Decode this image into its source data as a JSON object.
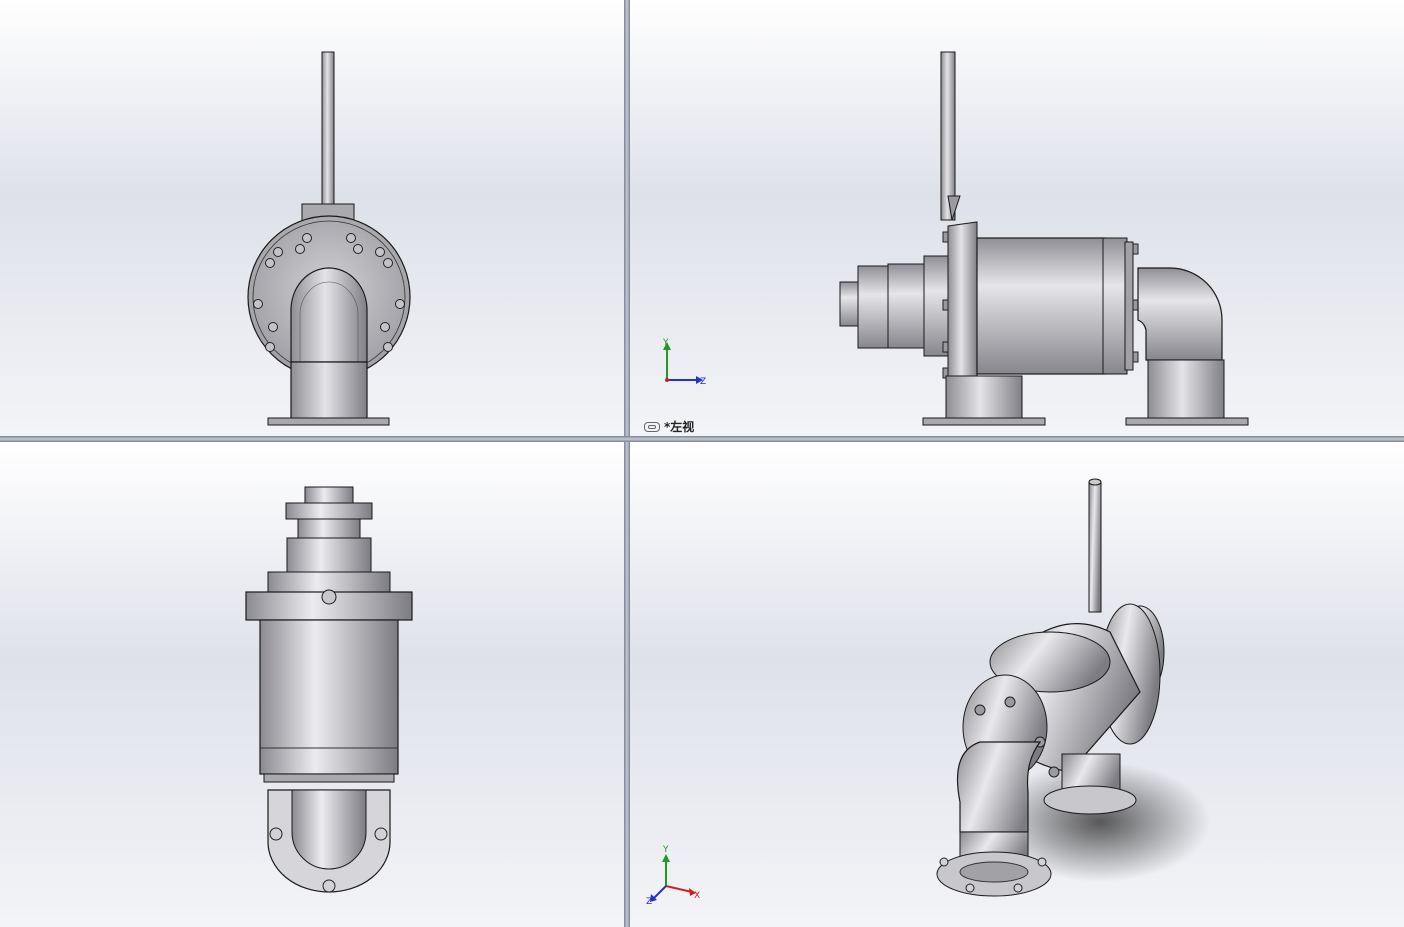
{
  "viewports": {
    "top_left": {
      "name": "front-view"
    },
    "top_right": {
      "name": "left-view",
      "label": "*左视",
      "triad": {
        "y": "Y",
        "z": "Z"
      }
    },
    "bottom_left": {
      "name": "top-view"
    },
    "bottom_right": {
      "name": "isometric-view",
      "triad": {
        "y": "Y",
        "x": "X",
        "z": "Z"
      }
    }
  },
  "colors": {
    "part_fill": "#b9b9bd",
    "part_dark": "#7a7a80",
    "part_light": "#e2e2e6",
    "outline": "#1a1a1a",
    "axis_x": "#cc2222",
    "axis_y": "#229922",
    "axis_z": "#2233cc"
  }
}
